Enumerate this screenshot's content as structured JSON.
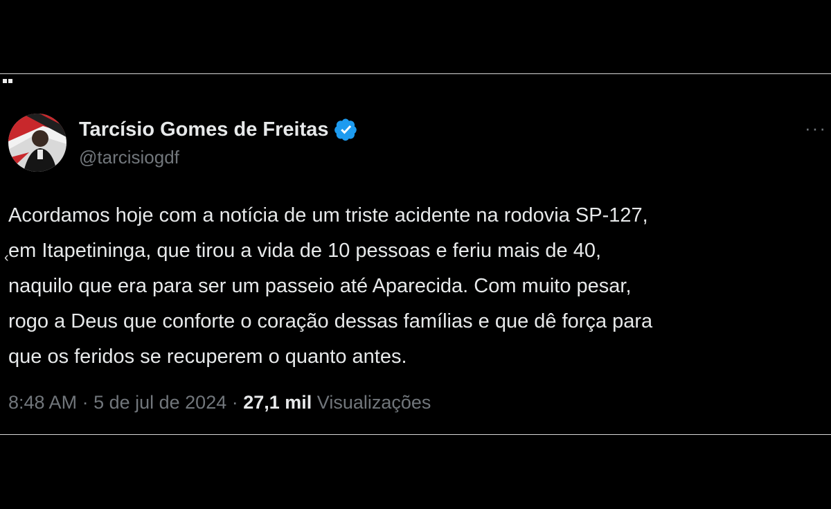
{
  "tweet": {
    "author_name": "Tarcísio Gomes de Freitas",
    "author_handle": "@tarcisiogdf",
    "verified_icon": "verified-badge-icon",
    "more_label": "···",
    "text": "Acordamos hoje com a notícia de um triste acidente na rodovia SP-127,\nem Itapetininga, que tirou a vida de 10 pessoas e feriu mais de 40,\nnaquilo que era para ser um passeio até Aparecida. Com muito pesar,\nrogo a Deus que conforte o coração dessas famílias e que dê força para\nque os feridos se recuperem o quanto antes.",
    "time": "8:48 AM",
    "sep1": " · ",
    "date": "5 de jul de 2024",
    "sep2": " · ",
    "views_count": "27,1 mil",
    "views_label": " Visualizações"
  },
  "colors": {
    "background": "#000000",
    "primary_text": "#e7e9ea",
    "secondary_text": "#71767b",
    "verified": "#1d9bf0"
  }
}
